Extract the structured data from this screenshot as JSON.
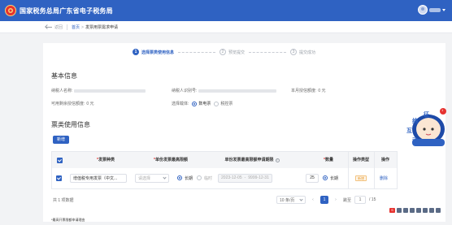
{
  "header": {
    "title": "国家税务总局广东省电子税务局"
  },
  "crumbs": {
    "back_label": "返回",
    "home": "首页",
    "separator": ">",
    "current": "发票用票需求申请"
  },
  "steps": [
    {
      "num": "1",
      "label": "选择票类使用信息",
      "active": true
    },
    {
      "num": "2",
      "label": "预览提交",
      "active": false
    },
    {
      "num": "3",
      "label": "提交成功",
      "active": false
    }
  ],
  "basic": {
    "title": "基本信息",
    "taxpayer_name_label": "纳税人名称:",
    "taxpayer_id_label": "纳税人识别号:",
    "month_limit_label": "本月授信额度:",
    "month_limit_value": "0 元",
    "available_limit_label": "可用剩余授信额度:",
    "available_limit_value": "0 元",
    "carrier_label": "选择载体:",
    "carrier_options": [
      "数电票",
      "税控票"
    ],
    "carrier_selected": "数电票"
  },
  "usage": {
    "title": "票类使用信息",
    "add_button": "新增",
    "columns": {
      "invoice_type": "发票种类",
      "max_amount": "单份发票最高限额",
      "period": "单份发票最高限额申请期限",
      "quantity": "数量",
      "op_type": "操作类型",
      "action": "操作"
    },
    "row": {
      "invoice_type": "增值税专用发票（中文...",
      "max_amount_placeholder": "请选择",
      "period_long": "长期",
      "period_short": "临时",
      "date_start": "2023-12-05",
      "date_sep": "-",
      "date_end": "9999-12-31",
      "quantity": "25",
      "qty_long": "长期",
      "op_type": "新增",
      "action": "删除"
    }
  },
  "pagination": {
    "total": "共 1 项数据",
    "page_size": "10 条/页",
    "current_page": "1",
    "goto_label": "跳至",
    "goto_value": "1",
    "page_suffix": "/ 15"
  },
  "note": "*最高开票限额申请理由",
  "mascot": {
    "badge": "1",
    "text_chars": [
      "征",
      "纳",
      "互",
      "动"
    ]
  },
  "colors": {
    "primary": "#2f62c2",
    "header_bg": "#2f62c2",
    "danger": "#e6322f",
    "warning": "#e89a2c"
  }
}
